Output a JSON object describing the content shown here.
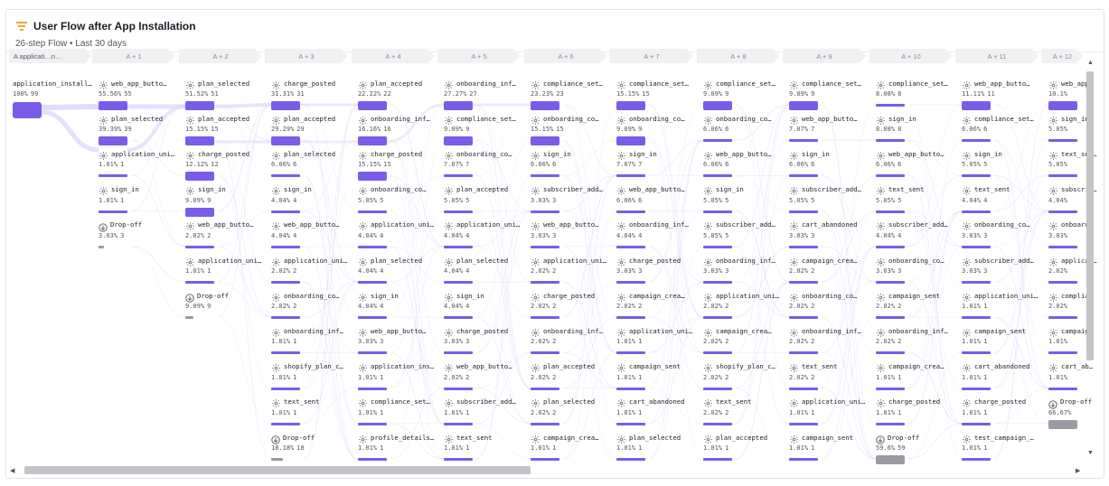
{
  "header": {
    "title": "User Flow after App Installation",
    "subtitle": "26-step Flow • Last 30 days"
  },
  "steps": [
    "applicati…n…",
    "A + 1",
    "A + 2",
    "A + 3",
    "A + 4",
    "A + 5",
    "A + 6",
    "A + 7",
    "A + 8",
    "A + 9",
    "A + 10",
    "A + 11",
    "A + 12"
  ],
  "colors": {
    "accent": "#7b5ce8",
    "dropoff": "#9b9ba3",
    "link": "#ded8fa"
  },
  "columns": [
    {
      "nodes": [
        {
          "name": "application_installed",
          "pct": "100%",
          "count": "99",
          "start": true
        }
      ]
    },
    {
      "nodes": [
        {
          "name": "web_app_butto…",
          "pct": "55.56%",
          "count": "55"
        },
        {
          "name": "plan_selected",
          "pct": "39.39%",
          "count": "39"
        },
        {
          "name": "application_uni…",
          "pct": "1.01%",
          "count": "1"
        },
        {
          "name": "sign_in",
          "pct": "1.01%",
          "count": "1"
        },
        {
          "name": "Drop-off",
          "pct": "3.03%",
          "count": "3",
          "drop": true
        }
      ]
    },
    {
      "nodes": [
        {
          "name": "plan_selected",
          "pct": "51.52%",
          "count": "51"
        },
        {
          "name": "plan_accepted",
          "pct": "15.15%",
          "count": "15"
        },
        {
          "name": "charge_posted",
          "pct": "12.12%",
          "count": "12"
        },
        {
          "name": "sign_in",
          "pct": "9.09%",
          "count": "9"
        },
        {
          "name": "web_app_butto…",
          "pct": "2.02%",
          "count": "2"
        },
        {
          "name": "application_uni…",
          "pct": "1.01%",
          "count": "1"
        },
        {
          "name": "Drop-off",
          "pct": "9.09%",
          "count": "9",
          "drop": true
        }
      ]
    },
    {
      "nodes": [
        {
          "name": "charge_posted",
          "pct": "31.31%",
          "count": "31"
        },
        {
          "name": "plan_accepted",
          "pct": "29.29%",
          "count": "29"
        },
        {
          "name": "plan_selected",
          "pct": "6.06%",
          "count": "6"
        },
        {
          "name": "sign_in",
          "pct": "4.04%",
          "count": "4"
        },
        {
          "name": "web_app_butto…",
          "pct": "4.04%",
          "count": "4"
        },
        {
          "name": "application_uni…",
          "pct": "2.02%",
          "count": "2"
        },
        {
          "name": "onboarding_co…",
          "pct": "2.02%",
          "count": "2"
        },
        {
          "name": "onboarding_inf…",
          "pct": "1.01%",
          "count": "1"
        },
        {
          "name": "shopify_plan_c…",
          "pct": "1.01%",
          "count": "1"
        },
        {
          "name": "text_sent",
          "pct": "1.01%",
          "count": "1"
        },
        {
          "name": "Drop-off",
          "pct": "18.18%",
          "count": "18",
          "drop": true
        }
      ]
    },
    {
      "nodes": [
        {
          "name": "plan_accepted",
          "pct": "22.22%",
          "count": "22"
        },
        {
          "name": "onboarding_inf…",
          "pct": "16.16%",
          "count": "16"
        },
        {
          "name": "charge_posted",
          "pct": "15.15%",
          "count": "15"
        },
        {
          "name": "onboarding_co…",
          "pct": "5.05%",
          "count": "5"
        },
        {
          "name": "application_uni…",
          "pct": "4.04%",
          "count": "4"
        },
        {
          "name": "plan_selected",
          "pct": "4.04%",
          "count": "4"
        },
        {
          "name": "sign_in",
          "pct": "4.04%",
          "count": "4"
        },
        {
          "name": "web_app_butto…",
          "pct": "3.03%",
          "count": "3"
        },
        {
          "name": "application_inst…",
          "pct": "1.01%",
          "count": "1"
        },
        {
          "name": "compliance_set…",
          "pct": "1.01%",
          "count": "1"
        },
        {
          "name": "profile_details_…",
          "pct": "1.01%",
          "count": "1"
        }
      ]
    },
    {
      "nodes": [
        {
          "name": "onboarding_inf…",
          "pct": "27.27%",
          "count": "27"
        },
        {
          "name": "compliance_set…",
          "pct": "9.09%",
          "count": "9"
        },
        {
          "name": "onboarding_co…",
          "pct": "7.07%",
          "count": "7"
        },
        {
          "name": "plan_accepted",
          "pct": "5.05%",
          "count": "5"
        },
        {
          "name": "application_uni…",
          "pct": "4.04%",
          "count": "4"
        },
        {
          "name": "plan_selected",
          "pct": "4.04%",
          "count": "4"
        },
        {
          "name": "sign_in",
          "pct": "4.04%",
          "count": "4"
        },
        {
          "name": "charge_posted",
          "pct": "3.03%",
          "count": "3"
        },
        {
          "name": "web_app_butto…",
          "pct": "2.02%",
          "count": "2"
        },
        {
          "name": "subscriber_add…",
          "pct": "1.01%",
          "count": "1"
        },
        {
          "name": "text_sent",
          "pct": "1.01%",
          "count": "1"
        }
      ]
    },
    {
      "nodes": [
        {
          "name": "compliance_set…",
          "pct": "23.23%",
          "count": "23"
        },
        {
          "name": "onboarding_co…",
          "pct": "15.15%",
          "count": "15"
        },
        {
          "name": "sign_in",
          "pct": "6.06%",
          "count": "6"
        },
        {
          "name": "subscriber_add…",
          "pct": "3.03%",
          "count": "3"
        },
        {
          "name": "web_app_butto…",
          "pct": "3.03%",
          "count": "3"
        },
        {
          "name": "application_uni…",
          "pct": "2.02%",
          "count": "2"
        },
        {
          "name": "charge_posted",
          "pct": "2.02%",
          "count": "2"
        },
        {
          "name": "onboarding_inf…",
          "pct": "2.02%",
          "count": "2"
        },
        {
          "name": "plan_accepted",
          "pct": "2.02%",
          "count": "2"
        },
        {
          "name": "plan_selected",
          "pct": "2.02%",
          "count": "2"
        },
        {
          "name": "campaign_crea…",
          "pct": "1.01%",
          "count": "1"
        }
      ]
    },
    {
      "nodes": [
        {
          "name": "compliance_set…",
          "pct": "15.15%",
          "count": "15"
        },
        {
          "name": "onboarding_co…",
          "pct": "9.09%",
          "count": "9"
        },
        {
          "name": "sign_in",
          "pct": "7.07%",
          "count": "7"
        },
        {
          "name": "web_app_butto…",
          "pct": "6.06%",
          "count": "6"
        },
        {
          "name": "onboarding_inf…",
          "pct": "4.04%",
          "count": "4"
        },
        {
          "name": "charge_posted",
          "pct": "3.03%",
          "count": "3"
        },
        {
          "name": "campaign_crea…",
          "pct": "2.02%",
          "count": "2"
        },
        {
          "name": "application_uni…",
          "pct": "1.01%",
          "count": "1"
        },
        {
          "name": "campaign_sent",
          "pct": "1.01%",
          "count": "1"
        },
        {
          "name": "cart_abandoned",
          "pct": "1.01%",
          "count": "1"
        },
        {
          "name": "plan_selected",
          "pct": "1.01%",
          "count": "1"
        }
      ]
    },
    {
      "nodes": [
        {
          "name": "compliance_set…",
          "pct": "9.09%",
          "count": "9"
        },
        {
          "name": "onboarding_co…",
          "pct": "6.06%",
          "count": "6"
        },
        {
          "name": "web_app_butto…",
          "pct": "6.06%",
          "count": "6"
        },
        {
          "name": "sign_in",
          "pct": "5.05%",
          "count": "5"
        },
        {
          "name": "subscriber_add…",
          "pct": "5.05%",
          "count": "5"
        },
        {
          "name": "onboarding_inf…",
          "pct": "3.03%",
          "count": "3"
        },
        {
          "name": "application_uni…",
          "pct": "2.02%",
          "count": "2"
        },
        {
          "name": "campaign_crea…",
          "pct": "2.02%",
          "count": "2"
        },
        {
          "name": "shopify_plan_c…",
          "pct": "2.02%",
          "count": "2"
        },
        {
          "name": "text_sent",
          "pct": "2.02%",
          "count": "2"
        },
        {
          "name": "plan_accepted",
          "pct": "1.01%",
          "count": "1"
        }
      ]
    },
    {
      "nodes": [
        {
          "name": "compliance_set…",
          "pct": "9.09%",
          "count": "9"
        },
        {
          "name": "web_app_butto…",
          "pct": "7.07%",
          "count": "7"
        },
        {
          "name": "sign_in",
          "pct": "6.06%",
          "count": "6"
        },
        {
          "name": "subscriber_add…",
          "pct": "5.05%",
          "count": "5"
        },
        {
          "name": "cart_abandoned",
          "pct": "3.03%",
          "count": "3"
        },
        {
          "name": "campaign_crea…",
          "pct": "2.02%",
          "count": "2"
        },
        {
          "name": "onboarding_co…",
          "pct": "2.02%",
          "count": "2"
        },
        {
          "name": "onboarding_inf…",
          "pct": "2.02%",
          "count": "2"
        },
        {
          "name": "text_sent",
          "pct": "2.02%",
          "count": "2"
        },
        {
          "name": "application_uni…",
          "pct": "1.01%",
          "count": "1"
        },
        {
          "name": "campaign_sent",
          "pct": "1.01%",
          "count": "1"
        }
      ]
    },
    {
      "nodes": [
        {
          "name": "compliance_set…",
          "pct": "8.08%",
          "count": "8"
        },
        {
          "name": "sign_in",
          "pct": "8.08%",
          "count": "8"
        },
        {
          "name": "web_app_butto…",
          "pct": "6.06%",
          "count": "6"
        },
        {
          "name": "text_sent",
          "pct": "5.05%",
          "count": "5"
        },
        {
          "name": "subscriber_add…",
          "pct": "4.04%",
          "count": "4"
        },
        {
          "name": "onboarding_co…",
          "pct": "3.03%",
          "count": "3"
        },
        {
          "name": "campaign_sent",
          "pct": "2.02%",
          "count": "2"
        },
        {
          "name": "onboarding_inf…",
          "pct": "2.02%",
          "count": "2"
        },
        {
          "name": "campaign_crea…",
          "pct": "1.01%",
          "count": "1"
        },
        {
          "name": "charge_posted",
          "pct": "1.01%",
          "count": "1"
        },
        {
          "name": "Drop-off",
          "pct": "59.6%",
          "count": "59",
          "drop": true
        }
      ]
    },
    {
      "nodes": [
        {
          "name": "web_app_butto…",
          "pct": "11.11%",
          "count": "11"
        },
        {
          "name": "compliance_set…",
          "pct": "6.06%",
          "count": "6"
        },
        {
          "name": "sign_in",
          "pct": "5.05%",
          "count": "5"
        },
        {
          "name": "text_sent",
          "pct": "4.04%",
          "count": "4"
        },
        {
          "name": "onboarding_co…",
          "pct": "3.03%",
          "count": "3"
        },
        {
          "name": "subscriber_add…",
          "pct": "3.03%",
          "count": "3"
        },
        {
          "name": "application_uni…",
          "pct": "1.01%",
          "count": "1"
        },
        {
          "name": "campaign_sent",
          "pct": "1.01%",
          "count": "1"
        },
        {
          "name": "cart_abandoned",
          "pct": "1.01%",
          "count": "1"
        },
        {
          "name": "charge_posted",
          "pct": "1.01%",
          "count": "1"
        },
        {
          "name": "test_campaign_…",
          "pct": "1.01%",
          "count": "1"
        }
      ]
    },
    {
      "nodes": [
        {
          "name": "web_app…",
          "pct": "10.1%",
          "count": ""
        },
        {
          "name": "sign_in",
          "pct": "5.05%",
          "count": ""
        },
        {
          "name": "text_sen…",
          "pct": "5.05%",
          "count": ""
        },
        {
          "name": "subscrib…",
          "pct": "4.04%",
          "count": ""
        },
        {
          "name": "onboard…",
          "pct": "3.03%",
          "count": ""
        },
        {
          "name": "applicat…",
          "pct": "2.02%",
          "count": ""
        },
        {
          "name": "complia…",
          "pct": "2.02%",
          "count": ""
        },
        {
          "name": "campaig…",
          "pct": "1.01%",
          "count": ""
        },
        {
          "name": "cart_ab…",
          "pct": "1.01%",
          "count": ""
        },
        {
          "name": "Drop-off",
          "pct": "66.67%",
          "count": "",
          "drop": true
        }
      ]
    }
  ]
}
